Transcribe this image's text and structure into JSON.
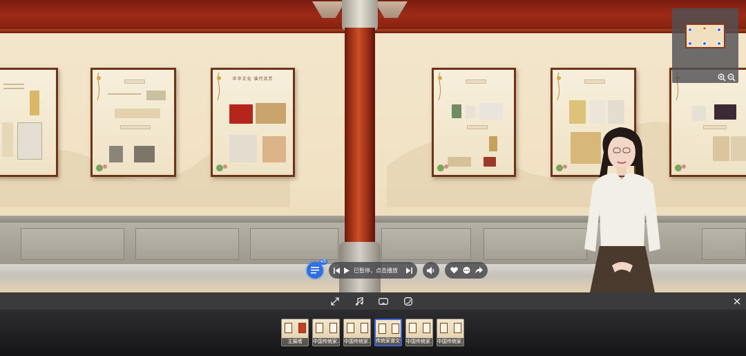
{
  "player": {
    "status_text": "已暂停，点击播放",
    "list_badge": "4/5"
  },
  "thumbnails": [
    {
      "caption": "主展墙",
      "active": false
    },
    {
      "caption": "中国传统家...",
      "active": false
    },
    {
      "caption": "中国传统家...",
      "active": false
    },
    {
      "caption": "传统家谱文化",
      "active": true
    },
    {
      "caption": "中国传统家...",
      "active": false
    },
    {
      "caption": "中国传统家...",
      "active": false
    }
  ],
  "boards": [
    {
      "title": ""
    },
    {
      "title": ""
    },
    {
      "title": "中华文化 谱代流芳"
    },
    {
      "title": ""
    },
    {
      "title": ""
    },
    {
      "title": ""
    }
  ],
  "icons": {
    "list": "playlist-icon",
    "prev": "skip-previous-icon",
    "play": "play-icon",
    "next": "skip-next-icon",
    "sound": "speaker-icon",
    "like": "heart-icon",
    "comment": "comment-icon",
    "share": "share-icon",
    "fullscreen": "expand-icon",
    "music": "music-icon",
    "vr": "vr-goggles-icon",
    "gyro": "gyroscope-icon",
    "close": "close-icon",
    "zoom_in": "zoom-in-icon",
    "zoom_out": "zoom-out-icon"
  },
  "colors": {
    "accent": "#2f6fe6",
    "pillar_red": "#b23c1c",
    "ceiling_red": "#8a2413",
    "wall": "#f1e2c4"
  }
}
